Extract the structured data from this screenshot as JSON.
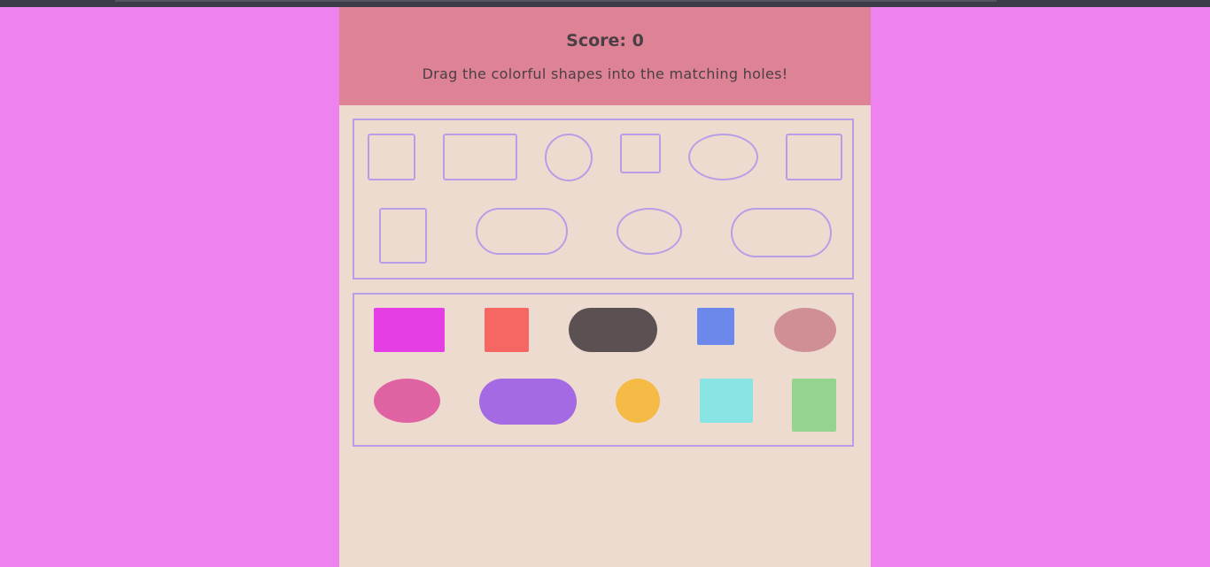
{
  "header": {
    "score_label": "Score: 0",
    "instructions": "Drag the colorful shapes into the matching holes!"
  },
  "colors": {
    "page_background": "#ee82ee",
    "game_background": "#eedbd0",
    "header_background": "#de8396",
    "outline": "#b79ee6"
  },
  "holes": [
    {
      "shape": "square"
    },
    {
      "shape": "rectangle"
    },
    {
      "shape": "circle"
    },
    {
      "shape": "square"
    },
    {
      "shape": "ellipse"
    },
    {
      "shape": "square"
    },
    {
      "shape": "rectangle"
    },
    {
      "shape": "pill"
    },
    {
      "shape": "ellipse"
    },
    {
      "shape": "pill"
    }
  ],
  "pieces": [
    {
      "shape": "rectangle",
      "color": "#e43ee4"
    },
    {
      "shape": "square",
      "color": "#f66663"
    },
    {
      "shape": "pill",
      "color": "#5c5152"
    },
    {
      "shape": "square",
      "color": "#6c88ea"
    },
    {
      "shape": "ellipse",
      "color": "#d08f95"
    },
    {
      "shape": "ellipse",
      "color": "#df63a3"
    },
    {
      "shape": "pill",
      "color": "#a36ae4"
    },
    {
      "shape": "circle",
      "color": "#f5b945"
    },
    {
      "shape": "rectangle",
      "color": "#89e4e4"
    },
    {
      "shape": "rectangle",
      "color": "#94d48f"
    }
  ]
}
